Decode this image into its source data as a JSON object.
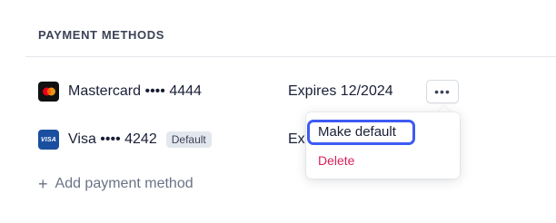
{
  "section": {
    "title": "PAYMENT METHODS"
  },
  "cards": [
    {
      "brand": "Mastercard",
      "label": "Mastercard •••• 4444",
      "expiry": "Expires 12/2024",
      "badge": ""
    },
    {
      "brand": "Visa",
      "brand_mark": "VISA",
      "label": "Visa •••• 4242",
      "expiry": "Ex",
      "badge": "Default"
    }
  ],
  "more_button": {
    "label": "•••"
  },
  "menu": {
    "items": [
      "Make default",
      "Delete"
    ]
  },
  "add_link": {
    "icon": "+",
    "label": "Add payment method"
  },
  "colors": {
    "accent": "#3d5bf5",
    "danger": "#d9235b",
    "muted": "#697386"
  }
}
